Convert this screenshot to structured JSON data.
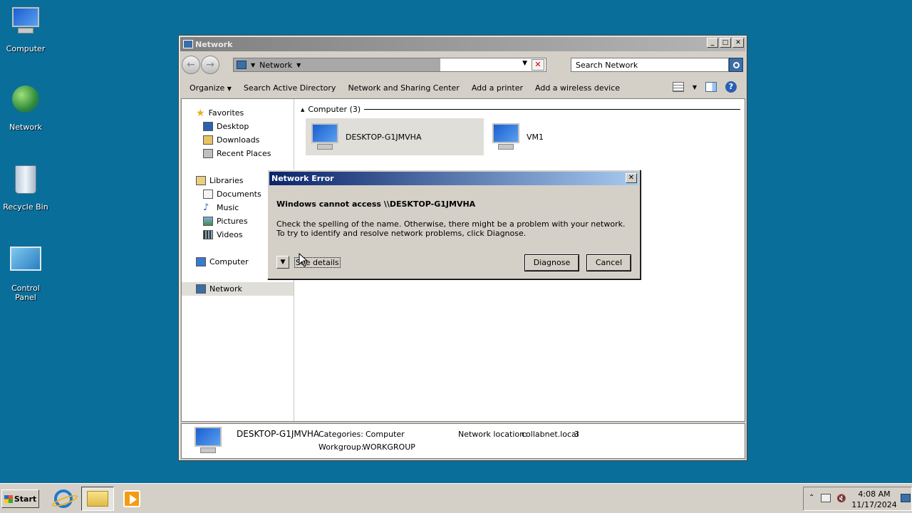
{
  "desktop": {
    "icons": [
      {
        "label": "Computer"
      },
      {
        "label": "Network"
      },
      {
        "label": "Recycle Bin"
      },
      {
        "label": "Control Panel"
      }
    ]
  },
  "window": {
    "title": "Network",
    "address": {
      "crumb": "Network"
    },
    "search": {
      "placeholder": "Search Network"
    },
    "toolbar": {
      "organize": "Organize",
      "search_ad": "Search Active Directory",
      "network_center": "Network and Sharing Center",
      "add_printer": "Add a printer",
      "add_wireless": "Add a wireless device"
    },
    "nav": {
      "favorites": "Favorites",
      "desktop": "Desktop",
      "downloads": "Downloads",
      "recent": "Recent Places",
      "libraries": "Libraries",
      "documents": "Documents",
      "music": "Music",
      "pictures": "Pictures",
      "videos": "Videos",
      "computer": "Computer",
      "network": "Network"
    },
    "group": {
      "label": "Computer (3)"
    },
    "items": [
      {
        "name": "DESKTOP-G1JMVHA"
      },
      {
        "name": "VM1"
      }
    ],
    "details": {
      "name": "DESKTOP-G1JMVHA",
      "categories_label": "Categories:",
      "categories_value": "Computer",
      "workgroup_label": "Workgroup:",
      "workgroup_value": "WORKGROUP",
      "location_label": "Network location:",
      "location_value": "collabnet.local",
      "location_suffix": "3"
    }
  },
  "dialog": {
    "title": "Network Error",
    "heading": "Windows cannot access \\\\DESKTOP-G1JMVHA",
    "body": "Check the spelling of the name. Otherwise, there might be a problem with your network. To try to identify and resolve network problems, click Diagnose.",
    "see_details": "See details",
    "diagnose": "Diagnose",
    "cancel": "Cancel"
  },
  "taskbar": {
    "start": "Start",
    "time": "4:08 AM",
    "date": "11/17/2024"
  },
  "colors": {
    "desktop": "#0a6e9b",
    "dialog_title_start": "#0a246a",
    "dialog_title_end": "#a6caf0"
  }
}
